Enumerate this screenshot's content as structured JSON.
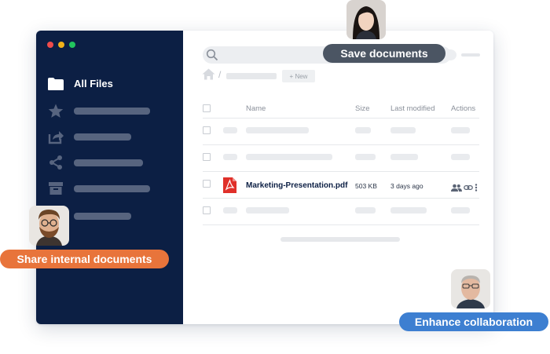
{
  "sidebar": {
    "items": [
      {
        "label": "All Files",
        "icon": "folder-icon"
      },
      {
        "label": "",
        "icon": "star-icon"
      },
      {
        "label": "",
        "icon": "share-out-icon"
      },
      {
        "label": "",
        "icon": "share-nodes-icon"
      },
      {
        "label": "",
        "icon": "archive-icon"
      },
      {
        "label": "",
        "icon": "trash-icon"
      }
    ]
  },
  "toolbar": {
    "new_label": "+ New"
  },
  "table": {
    "headers": {
      "name": "Name",
      "size": "Size",
      "modified": "Last modified",
      "actions": "Actions"
    },
    "file": {
      "name": "Marketing-Presentation.pdf",
      "size": "503 KB",
      "modified": "3 days ago"
    }
  },
  "callouts": {
    "save": "Save documents",
    "share": "Share internal documents",
    "collaborate": "Enhance collaboration"
  },
  "colors": {
    "sidebar": "#0c1f44",
    "save": "#4b5563",
    "share": "#e8743b",
    "collaborate": "#3d7fd1",
    "pdf": "#e0302a"
  }
}
